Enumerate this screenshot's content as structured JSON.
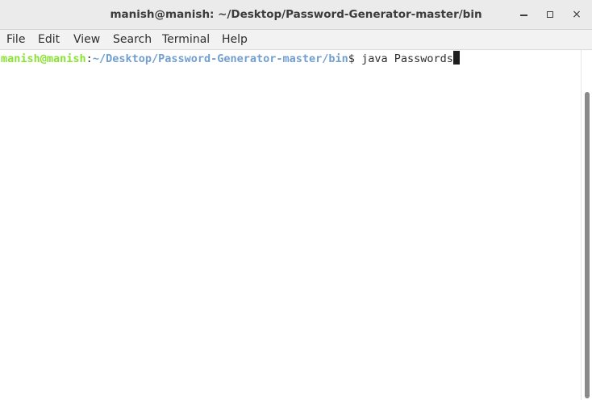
{
  "window": {
    "title": "manish@manish: ~/Desktop/Password-Generator-master/bin",
    "minimize_icon": "minimize-icon",
    "maximize_icon": "maximize-icon",
    "close_icon": "close-icon",
    "close_glyph": "×"
  },
  "menu": {
    "items": [
      "File",
      "Edit",
      "View",
      "Search",
      "Terminal",
      "Help"
    ]
  },
  "terminal": {
    "prompt_user_host": "manish@manish",
    "prompt_colon": ":",
    "prompt_path": "~/Desktop/Password-Generator-master/bin",
    "prompt_symbol": "$ ",
    "command": "java Passwords"
  },
  "colors": {
    "user_host": "#8ae234",
    "path": "#729fcf",
    "text": "#2e2e2e",
    "background": "#ffffff"
  }
}
